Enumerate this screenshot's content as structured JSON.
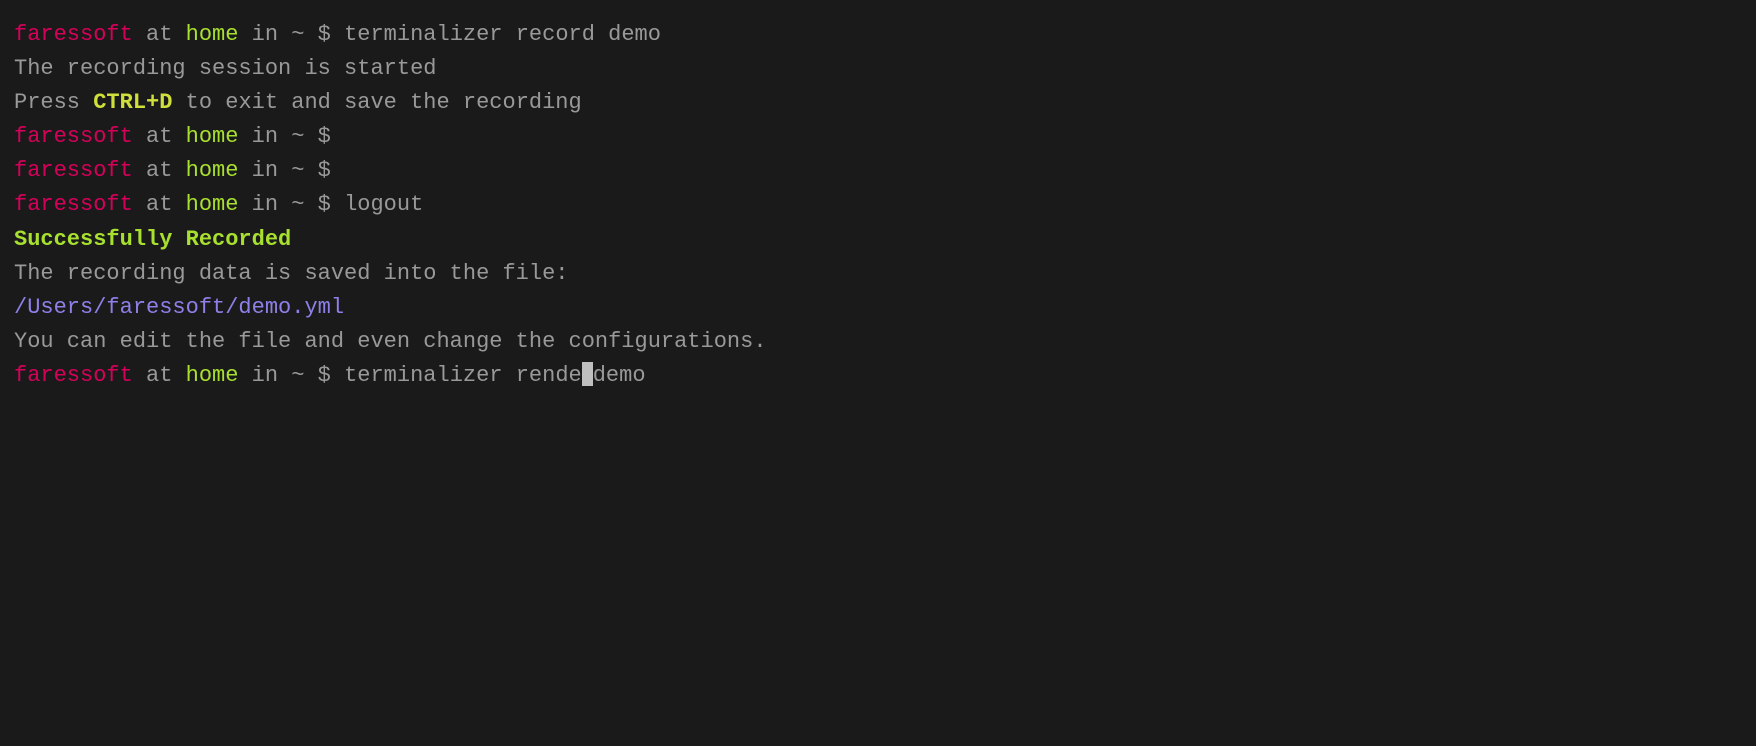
{
  "prompt": {
    "user": "faressoft",
    "at": " at ",
    "host": "home",
    "in_text": " in ",
    "path": "~",
    "symbol": " $ "
  },
  "lines": {
    "cmd1": "terminalizer record demo",
    "msg_started": "The recording session is started",
    "press_text": "Press ",
    "ctrl_d": "CTRL+D",
    "exit_text": " to exit and save the recording",
    "cmd_logout": "logout",
    "success": "Successfully Recorded",
    "saved_msg": "The recording data is saved into the file:",
    "file_path": "/Users/faressoft/demo.yml",
    "edit_msg": "You can edit the file and even change the configurations.",
    "cmd_partial_before": "terminalizer rende",
    "cmd_partial_after": "demo"
  }
}
